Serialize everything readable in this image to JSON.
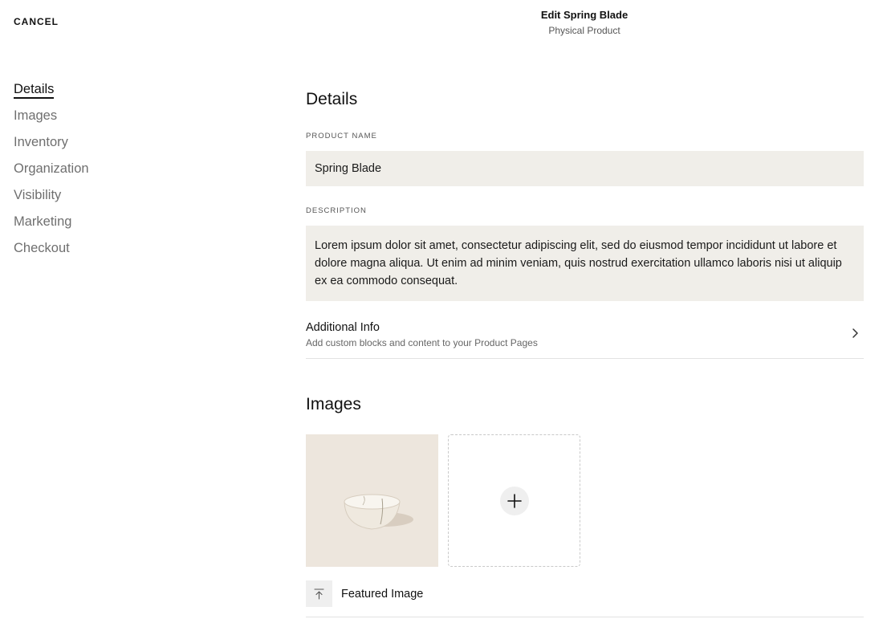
{
  "header": {
    "cancel_label": "CANCEL",
    "title": "Edit Spring Blade",
    "subtitle": "Physical Product"
  },
  "sidebar": {
    "items": [
      {
        "label": "Details",
        "active": true
      },
      {
        "label": "Images",
        "active": false
      },
      {
        "label": "Inventory",
        "active": false
      },
      {
        "label": "Organization",
        "active": false
      },
      {
        "label": "Visibility",
        "active": false
      },
      {
        "label": "Marketing",
        "active": false
      },
      {
        "label": "Checkout",
        "active": false
      }
    ]
  },
  "details": {
    "title": "Details",
    "product_name_label": "PRODUCT NAME",
    "product_name_value": "Spring Blade",
    "description_label": "DESCRIPTION",
    "description_value": "Lorem ipsum dolor sit amet, consectetur adipiscing elit, sed do eiusmod tempor incididunt ut labore et dolore magna aliqua. Ut enim ad minim veniam, quis nostrud exercitation ullamco laboris nisi ut aliquip ex ea commodo consequat.",
    "additional_info_title": "Additional Info",
    "additional_info_subtitle": "Add custom blocks and content to your Product Pages"
  },
  "images": {
    "title": "Images",
    "featured_label": "Featured Image"
  },
  "icons": {
    "chevron": "chevron-right-icon",
    "add": "plus-icon",
    "featured": "arrow-up-to-line-icon"
  },
  "colors": {
    "input_bg": "#f0eee9",
    "image_bg": "#ede6dd",
    "accent": "#111111"
  }
}
